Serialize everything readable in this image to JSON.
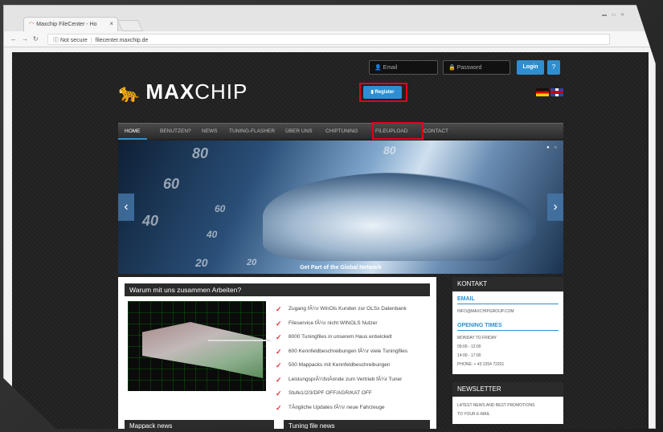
{
  "browser": {
    "tab_title": "Maxchip FileCenter - Ho",
    "url_security": "Not secure",
    "url": "filecenter.maxchip.de",
    "window_controls": "▬ ▭ ✕"
  },
  "header": {
    "logo_bold": "MAX",
    "logo_light": "CHIP",
    "email_placeholder": "Email",
    "password_placeholder": "Password",
    "login_label": "Login",
    "help_label": "?",
    "register_label": "Register"
  },
  "nav": {
    "items": [
      "Home",
      "Benutzen?",
      "News",
      "Tuning-Flasher",
      "Über uns",
      "Chiptuning",
      "Fileupload",
      "Contact"
    ]
  },
  "hero": {
    "caption": "Get Part of the Global Network",
    "speed_numbers": [
      "80",
      "60",
      "40",
      "20",
      "60",
      "80",
      "40",
      "20"
    ]
  },
  "main": {
    "box_title": "Warum mit uns zusammen Arbeiten?",
    "features": [
      "Zugang fÃ¼r WinOls Kunden zur OLSx Datenbank",
      "Fileservice fÃ¼r nicht WINOLS Nutzer",
      "8000 Tuningfiles in unserem Haus entwickelt",
      "600 Kennfeldbeschreibungen fÃ¼r viele Tuningfiles",
      "500 Mappacks mit Kennfeldbeschreibungen",
      "LeistungsprÃ¼fstÃ¤nde zum Vertrieb fÃ¼r Tuner",
      "Stufe1/2/3/DPF OFF/AGR/KAT OFF",
      "TÃ¤gliche Updates fÃ¼r neue Fahrzeuge"
    ],
    "mappack_news": "Mappack news",
    "tuning_file_news": "Tuning file news"
  },
  "sidebar": {
    "kontakt": "KONTAKT",
    "email_head": "EMAIL",
    "email": "INFO@MAXCHIPGROUP.COM",
    "opening_head": "OPENING TIMES",
    "days": "MONDAY TO FRIDAY",
    "time1": "09:00 - 12:00",
    "time2": "14:00 - 17:00",
    "phone": "PHONE: + 43 2254 72201",
    "newsletter": "NEWSLETTER",
    "newsletter_text1": "LATEST NEWS AND BEST PROMOTIONS",
    "newsletter_text2": "TO YOUR E-MAIL"
  },
  "colors": {
    "accent": "#2d8fd1",
    "highlight": "#e3001b",
    "nav_bg": "#2b2b2b"
  }
}
